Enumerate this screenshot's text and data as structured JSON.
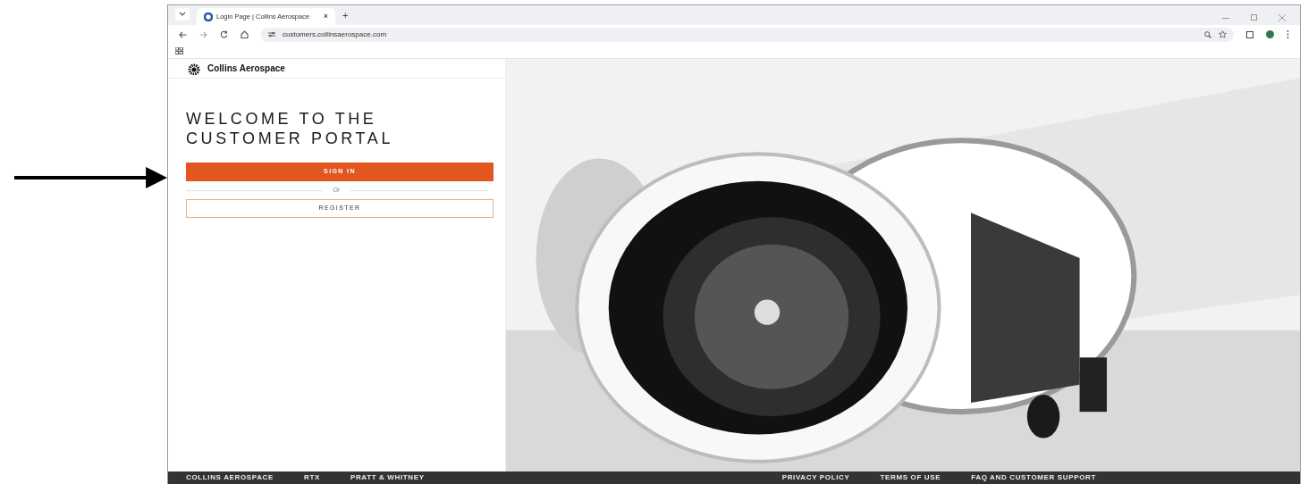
{
  "browser": {
    "tab_title": "Login Page | Collins Aerospace",
    "new_tab": "+",
    "close_tab": "×",
    "url": "customers.collinsaerospace.com"
  },
  "header": {
    "logo_text": "Collins Aerospace"
  },
  "login": {
    "heading_lines": [
      "WELCOME TO THE",
      "CUSTOMER PORTAL"
    ],
    "sign_in": "SIGN IN",
    "separator": "Or",
    "register": "REGISTER"
  },
  "footer": {
    "left_links": [
      "COLLINS AEROSPACE",
      "RTX",
      "PRATT & WHITNEY"
    ],
    "right_links": [
      "PRIVACY POLICY",
      "TERMS OF USE",
      "FAQ AND CUSTOMER SUPPORT"
    ]
  }
}
